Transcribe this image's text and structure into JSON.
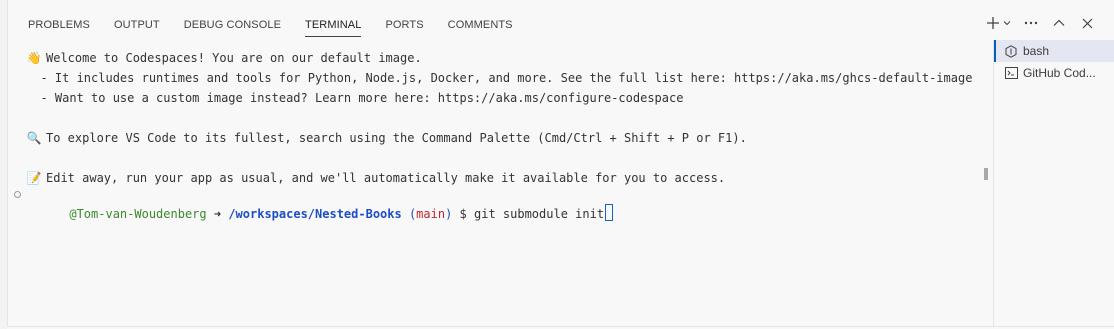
{
  "panel": {
    "tabs": [
      {
        "label": "PROBLEMS"
      },
      {
        "label": "OUTPUT"
      },
      {
        "label": "DEBUG CONSOLE"
      },
      {
        "label": "TERMINAL",
        "active": true
      },
      {
        "label": "PORTS"
      },
      {
        "label": "COMMENTS"
      }
    ],
    "actions": {
      "new_terminal_icon": "plus-icon",
      "dropdown_icon": "chevron-down-icon",
      "more_icon": "ellipsis-icon",
      "maximize_icon": "chevron-up-icon",
      "close_icon": "close-icon"
    }
  },
  "terminal": {
    "welcome_emoji": "👋",
    "welcome": "Welcome to Codespaces! You are on our default image.",
    "bullet1": "  - It includes runtimes and tools for Python, Node.js, Docker, and more. See the full list here: https://aka.ms/ghcs-default-image",
    "bullet2": "  - Want to use a custom image instead? Learn more here: https://aka.ms/configure-codespace",
    "explore_emoji": "🔍",
    "explore": "To explore VS Code to its fullest, search using the Command Palette (Cmd/Ctrl + Shift + P or F1).",
    "edit_emoji": "📝",
    "edit": "Edit away, run your app as usual, and we'll automatically make it available for you to access.",
    "prompt": {
      "user": "@Tom-van-Woudenberg",
      "arrow": " ➜ ",
      "path": "/workspaces/Nested-Books",
      "branch_open": " (",
      "branch": "main",
      "branch_close": ")",
      "symbol": " $ ",
      "command": "git submodule init"
    }
  },
  "terminal_list": [
    {
      "label": "bash",
      "icon": "terminal-bash-icon",
      "active": true
    },
    {
      "label": "GitHub Cod...",
      "icon": "terminal-icon",
      "active": false
    }
  ],
  "colors": {
    "user": "#3a8a2c",
    "path": "#1d4ec4",
    "branch": "#c4262b",
    "accent": "#005fb8"
  }
}
